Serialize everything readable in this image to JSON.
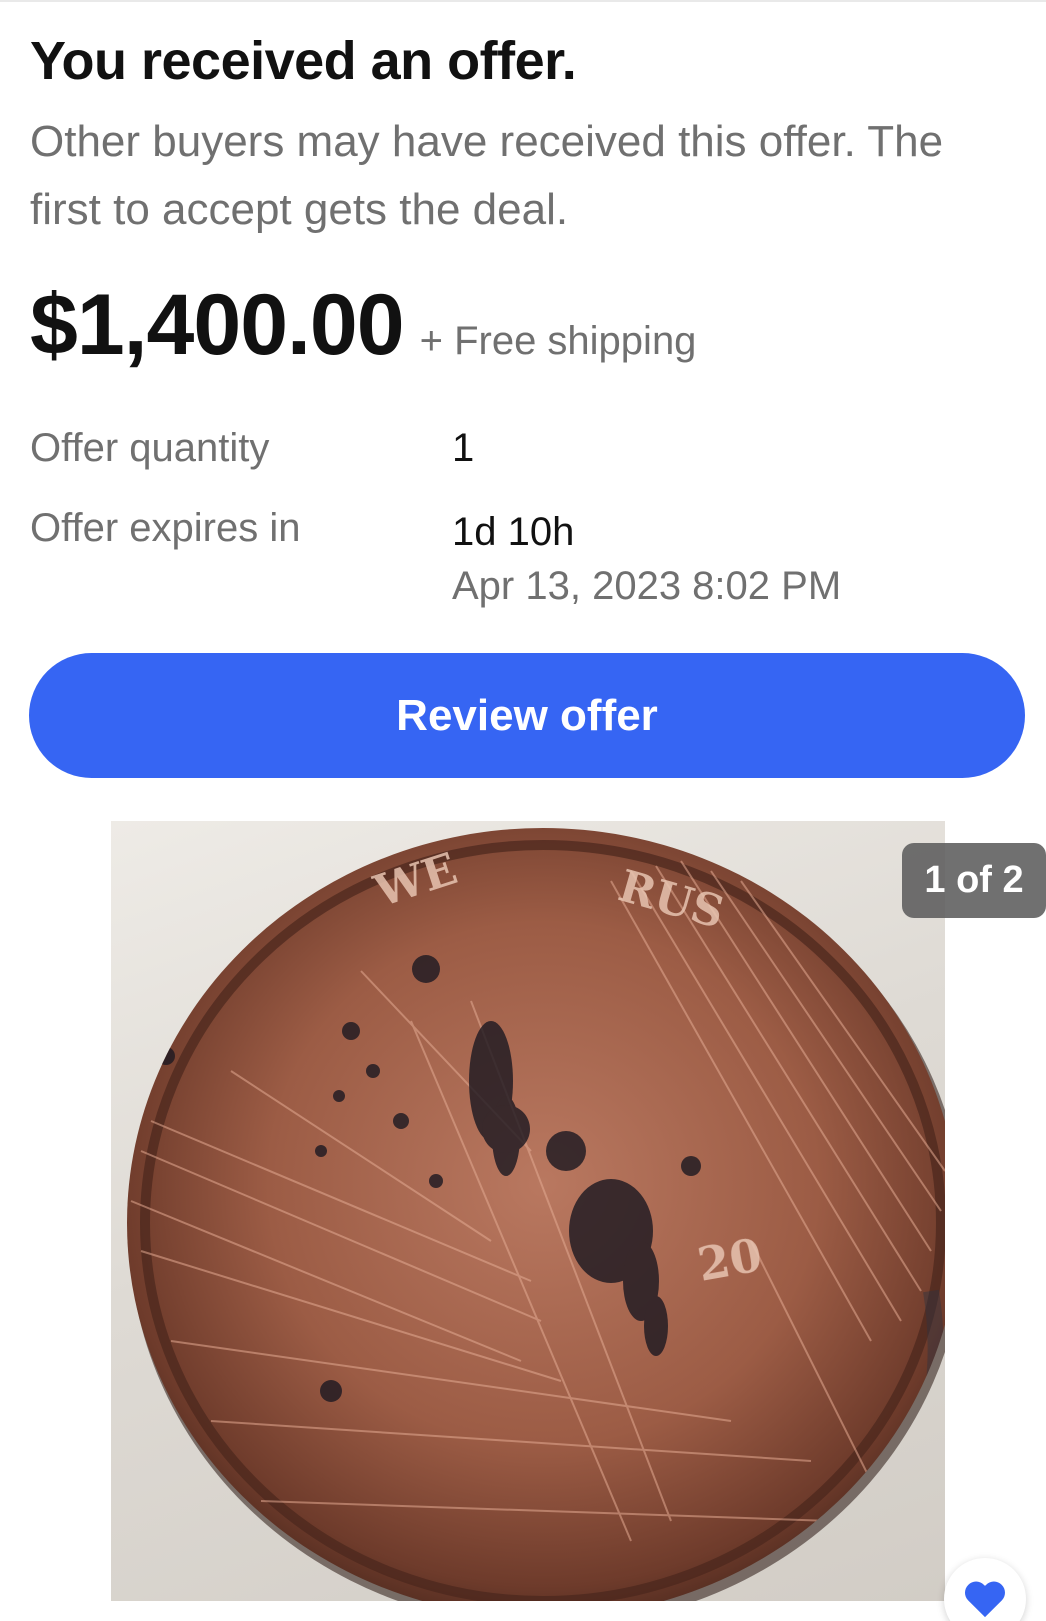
{
  "offer": {
    "title": "You received an offer.",
    "subtitle": "Other buyers may have received this offer. The first to accept gets the deal.",
    "price": "$1,400.00",
    "shipping": "+ Free shipping",
    "details": {
      "quantity_label": "Offer quantity",
      "quantity_value": "1",
      "expires_label": "Offer expires in",
      "expires_value": "1d 10h",
      "expires_date": "Apr 13, 2023 8:02 PM"
    },
    "review_button_label": "Review offer"
  },
  "gallery": {
    "pager": "1 of 2",
    "item_image_icon": "coin-photo",
    "watch_icon": "heart-icon"
  },
  "colors": {
    "accent": "#3665f3",
    "secondary_text": "#707070",
    "primary_text": "#111111"
  }
}
